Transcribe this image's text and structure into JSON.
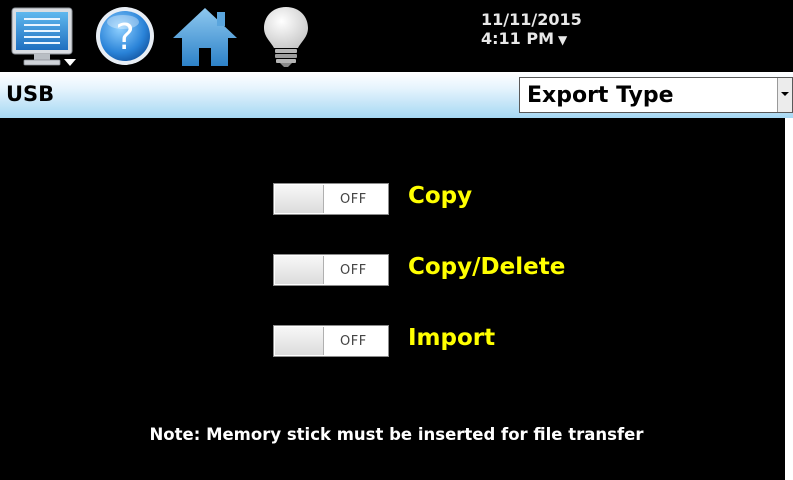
{
  "topbar": {
    "icons": {
      "menu": "monitor-menu-icon",
      "help": "help-icon",
      "home": "home-icon",
      "light": "lightbulb-icon"
    },
    "date": "11/11/2015",
    "time": "4:11 PM",
    "time_arrow": "▼"
  },
  "header": {
    "title": "USB",
    "export_type": {
      "selected": "Export Type"
    }
  },
  "options": [
    {
      "label": "Copy",
      "state": "OFF"
    },
    {
      "label": "Copy/Delete",
      "state": "OFF"
    },
    {
      "label": "Import",
      "state": "OFF"
    }
  ],
  "note": "Note:  Memory stick must be inserted for file transfer",
  "colors": {
    "background": "#000000",
    "option_label": "#ffff00",
    "header_gradient_bottom": "#a6d8f3"
  }
}
